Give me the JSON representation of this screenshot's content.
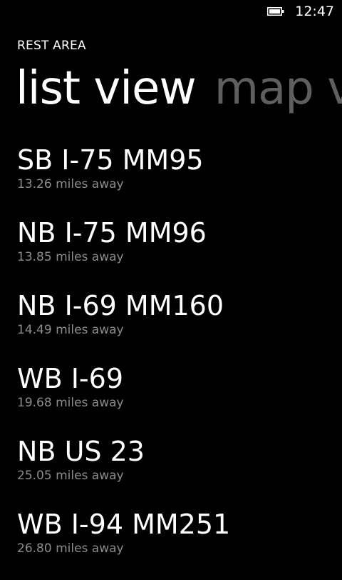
{
  "status_bar": {
    "battery_icon": "battery-full-icon",
    "time": "12:47"
  },
  "app": {
    "title": "REST AREA"
  },
  "pivot": {
    "active": "list view",
    "next": "map v"
  },
  "rest_areas": [
    {
      "name": "SB I-75 MM95",
      "distance": "13.26 miles away"
    },
    {
      "name": "NB I-75 MM96",
      "distance": "13.85 miles away"
    },
    {
      "name": "NB I-69 MM160",
      "distance": "14.49 miles away"
    },
    {
      "name": "WB I-69",
      "distance": "19.68 miles away"
    },
    {
      "name": "NB US 23",
      "distance": "25.05 miles away"
    },
    {
      "name": "WB I-94 MM251",
      "distance": "26.80 miles away"
    }
  ],
  "colors": {
    "background": "#000000",
    "primary_text": "#ffffff",
    "secondary_text": "#8c8c8c",
    "inactive_pivot": "#5f5f5f"
  }
}
